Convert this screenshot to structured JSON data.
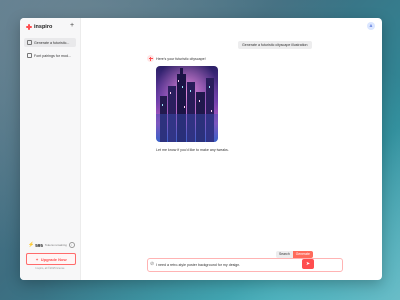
{
  "app": {
    "name": "inspiro"
  },
  "sidebar": {
    "items": [
      {
        "label": "Generate a futuristic..."
      },
      {
        "label": "Font pairings for mod..."
      }
    ],
    "credits": {
      "value": "595",
      "label": "Tokens remaining"
    },
    "upgrade_label": "Upgrade Now",
    "footer": "Inspiro, all ©2025 license"
  },
  "header": {
    "avatar_initial": "A"
  },
  "chat": {
    "user_message": "Generate a futuristic cityscape illustration",
    "bot_intro": "Here's your futuristic cityscape!",
    "bot_followup": "Let me know if you'd like to make any tweaks."
  },
  "composer": {
    "value": "I need a retro-style poster background for my design.",
    "modes": [
      "Search",
      "Generate"
    ],
    "active_mode": "Generate"
  },
  "colors": {
    "accent": "#ff4d4f"
  }
}
